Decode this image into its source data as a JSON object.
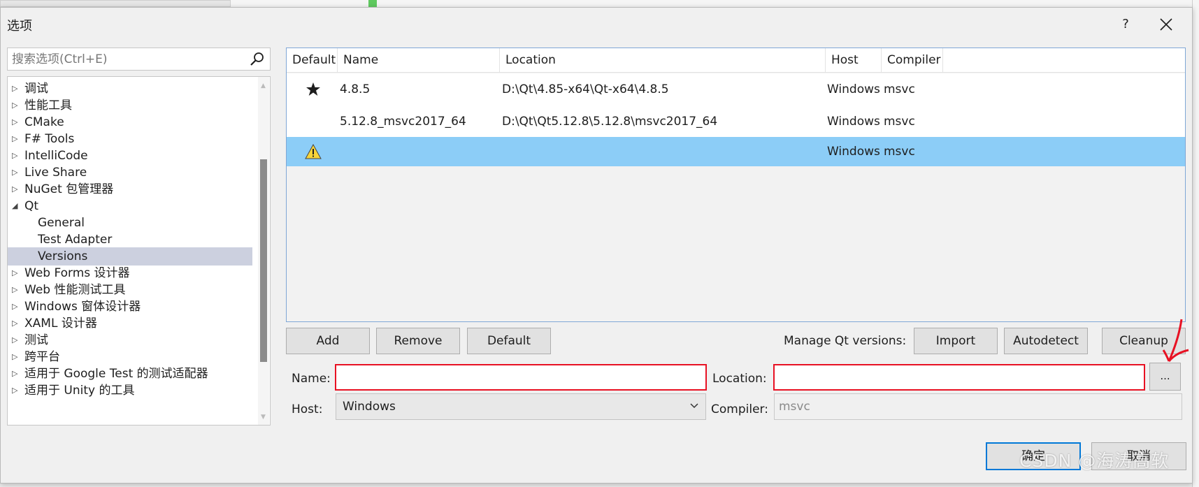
{
  "window": {
    "title": "选项",
    "help_label": "?"
  },
  "search": {
    "placeholder": "搜索选项(Ctrl+E)"
  },
  "tree": {
    "items": [
      {
        "label": "调试",
        "expanded": false
      },
      {
        "label": "性能工具",
        "expanded": false
      },
      {
        "label": "CMake",
        "expanded": false
      },
      {
        "label": "F# Tools",
        "expanded": false
      },
      {
        "label": "IntelliCode",
        "expanded": false
      },
      {
        "label": "Live Share",
        "expanded": false
      },
      {
        "label": "NuGet 包管理器",
        "expanded": false
      },
      {
        "label": "Qt",
        "expanded": true
      },
      {
        "label": "General",
        "child": true
      },
      {
        "label": "Test Adapter",
        "child": true
      },
      {
        "label": "Versions",
        "child": true,
        "selected": true
      },
      {
        "label": "Web Forms 设计器",
        "expanded": false
      },
      {
        "label": "Web 性能测试工具",
        "expanded": false
      },
      {
        "label": "Windows 窗体设计器",
        "expanded": false
      },
      {
        "label": "XAML 设计器",
        "expanded": false
      },
      {
        "label": "测试",
        "expanded": false
      },
      {
        "label": "跨平台",
        "expanded": false
      },
      {
        "label": "适用于 Google Test 的测试适配器",
        "expanded": false
      },
      {
        "label": "适用于 Unity 的工具",
        "expanded": false
      }
    ]
  },
  "versions_table": {
    "columns": {
      "default": "Default",
      "name": "Name",
      "location": "Location",
      "host": "Host",
      "compiler": "Compiler"
    },
    "rows": [
      {
        "default_icon": "star-icon",
        "name": "4.8.5",
        "location": "D:\\Qt\\4.85-x64\\Qt-x64\\4.8.5",
        "host": "Windows",
        "compiler": "msvc"
      },
      {
        "default_icon": "",
        "name": "5.12.8_msvc2017_64",
        "location": "D:\\Qt\\Qt5.12.8\\5.12.8\\msvc2017_64",
        "host": "Windows",
        "compiler": "msvc"
      },
      {
        "default_icon": "warning-icon",
        "name": "",
        "location": "",
        "host": "Windows",
        "compiler": "msvc",
        "selected": true
      }
    ]
  },
  "actions": {
    "add": "Add",
    "remove": "Remove",
    "default": "Default",
    "manage_label": "Manage Qt versions:",
    "import": "Import",
    "autodetect": "Autodetect",
    "cleanup": "Cleanup"
  },
  "form": {
    "name_label": "Name:",
    "name_value": "",
    "location_label": "Location:",
    "location_value": "",
    "browse_label": "...",
    "host_label": "Host:",
    "host_value": "Windows",
    "compiler_label": "Compiler:",
    "compiler_value": "msvc"
  },
  "footer": {
    "ok": "确定",
    "cancel": "取消"
  },
  "watermark": "CSDN @海涛高软",
  "colors": {
    "selection": "#8ccdf7",
    "error_border": "#e81123",
    "tree_selection": "#ccd0df",
    "accent": "#0078d7"
  }
}
